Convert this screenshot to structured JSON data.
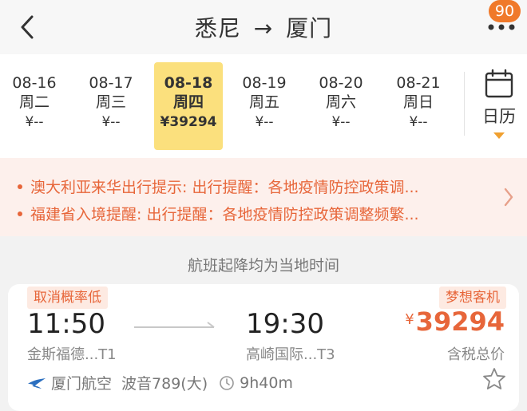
{
  "header": {
    "origin": "悉尼",
    "arrow": "→",
    "destination": "厦门",
    "badge": "90"
  },
  "dates": [
    {
      "date": "08-16",
      "weekday": "周二",
      "price": "¥--"
    },
    {
      "date": "08-17",
      "weekday": "周三",
      "price": "¥--"
    },
    {
      "date": "08-18",
      "weekday": "周四",
      "price": "¥39294",
      "selected": true
    },
    {
      "date": "08-19",
      "weekday": "周五",
      "price": "¥--"
    },
    {
      "date": "08-20",
      "weekday": "周六",
      "price": "¥--"
    },
    {
      "date": "08-21",
      "weekday": "周日",
      "price": "¥--"
    }
  ],
  "calendar": {
    "label": "日历"
  },
  "notices": [
    "澳大利亚来华出行提示: 出行提醒：各地疫情防控政策调...",
    "福建省入境提醒: 出行提醒：各地疫情防控政策调整频繁..."
  ],
  "local_time_note": "航班起降均为当地时间",
  "flight": {
    "tag_left": "取消概率低",
    "tag_right": "梦想客机",
    "dep_time": "11:50",
    "arr_time": "19:30",
    "dep_airport": "金斯福德...T1",
    "arr_airport": "高崎国际...T3",
    "currency": "¥",
    "price": "39294",
    "price_note": "含税总价",
    "airline": "厦门航空",
    "aircraft": "波音789(大)",
    "duration": "9h40m"
  },
  "colors": {
    "accent": "#e7663a",
    "selected_date_bg": "#fbe07d",
    "badge": "#f0792a",
    "notice_bg": "#fdf0ec"
  }
}
